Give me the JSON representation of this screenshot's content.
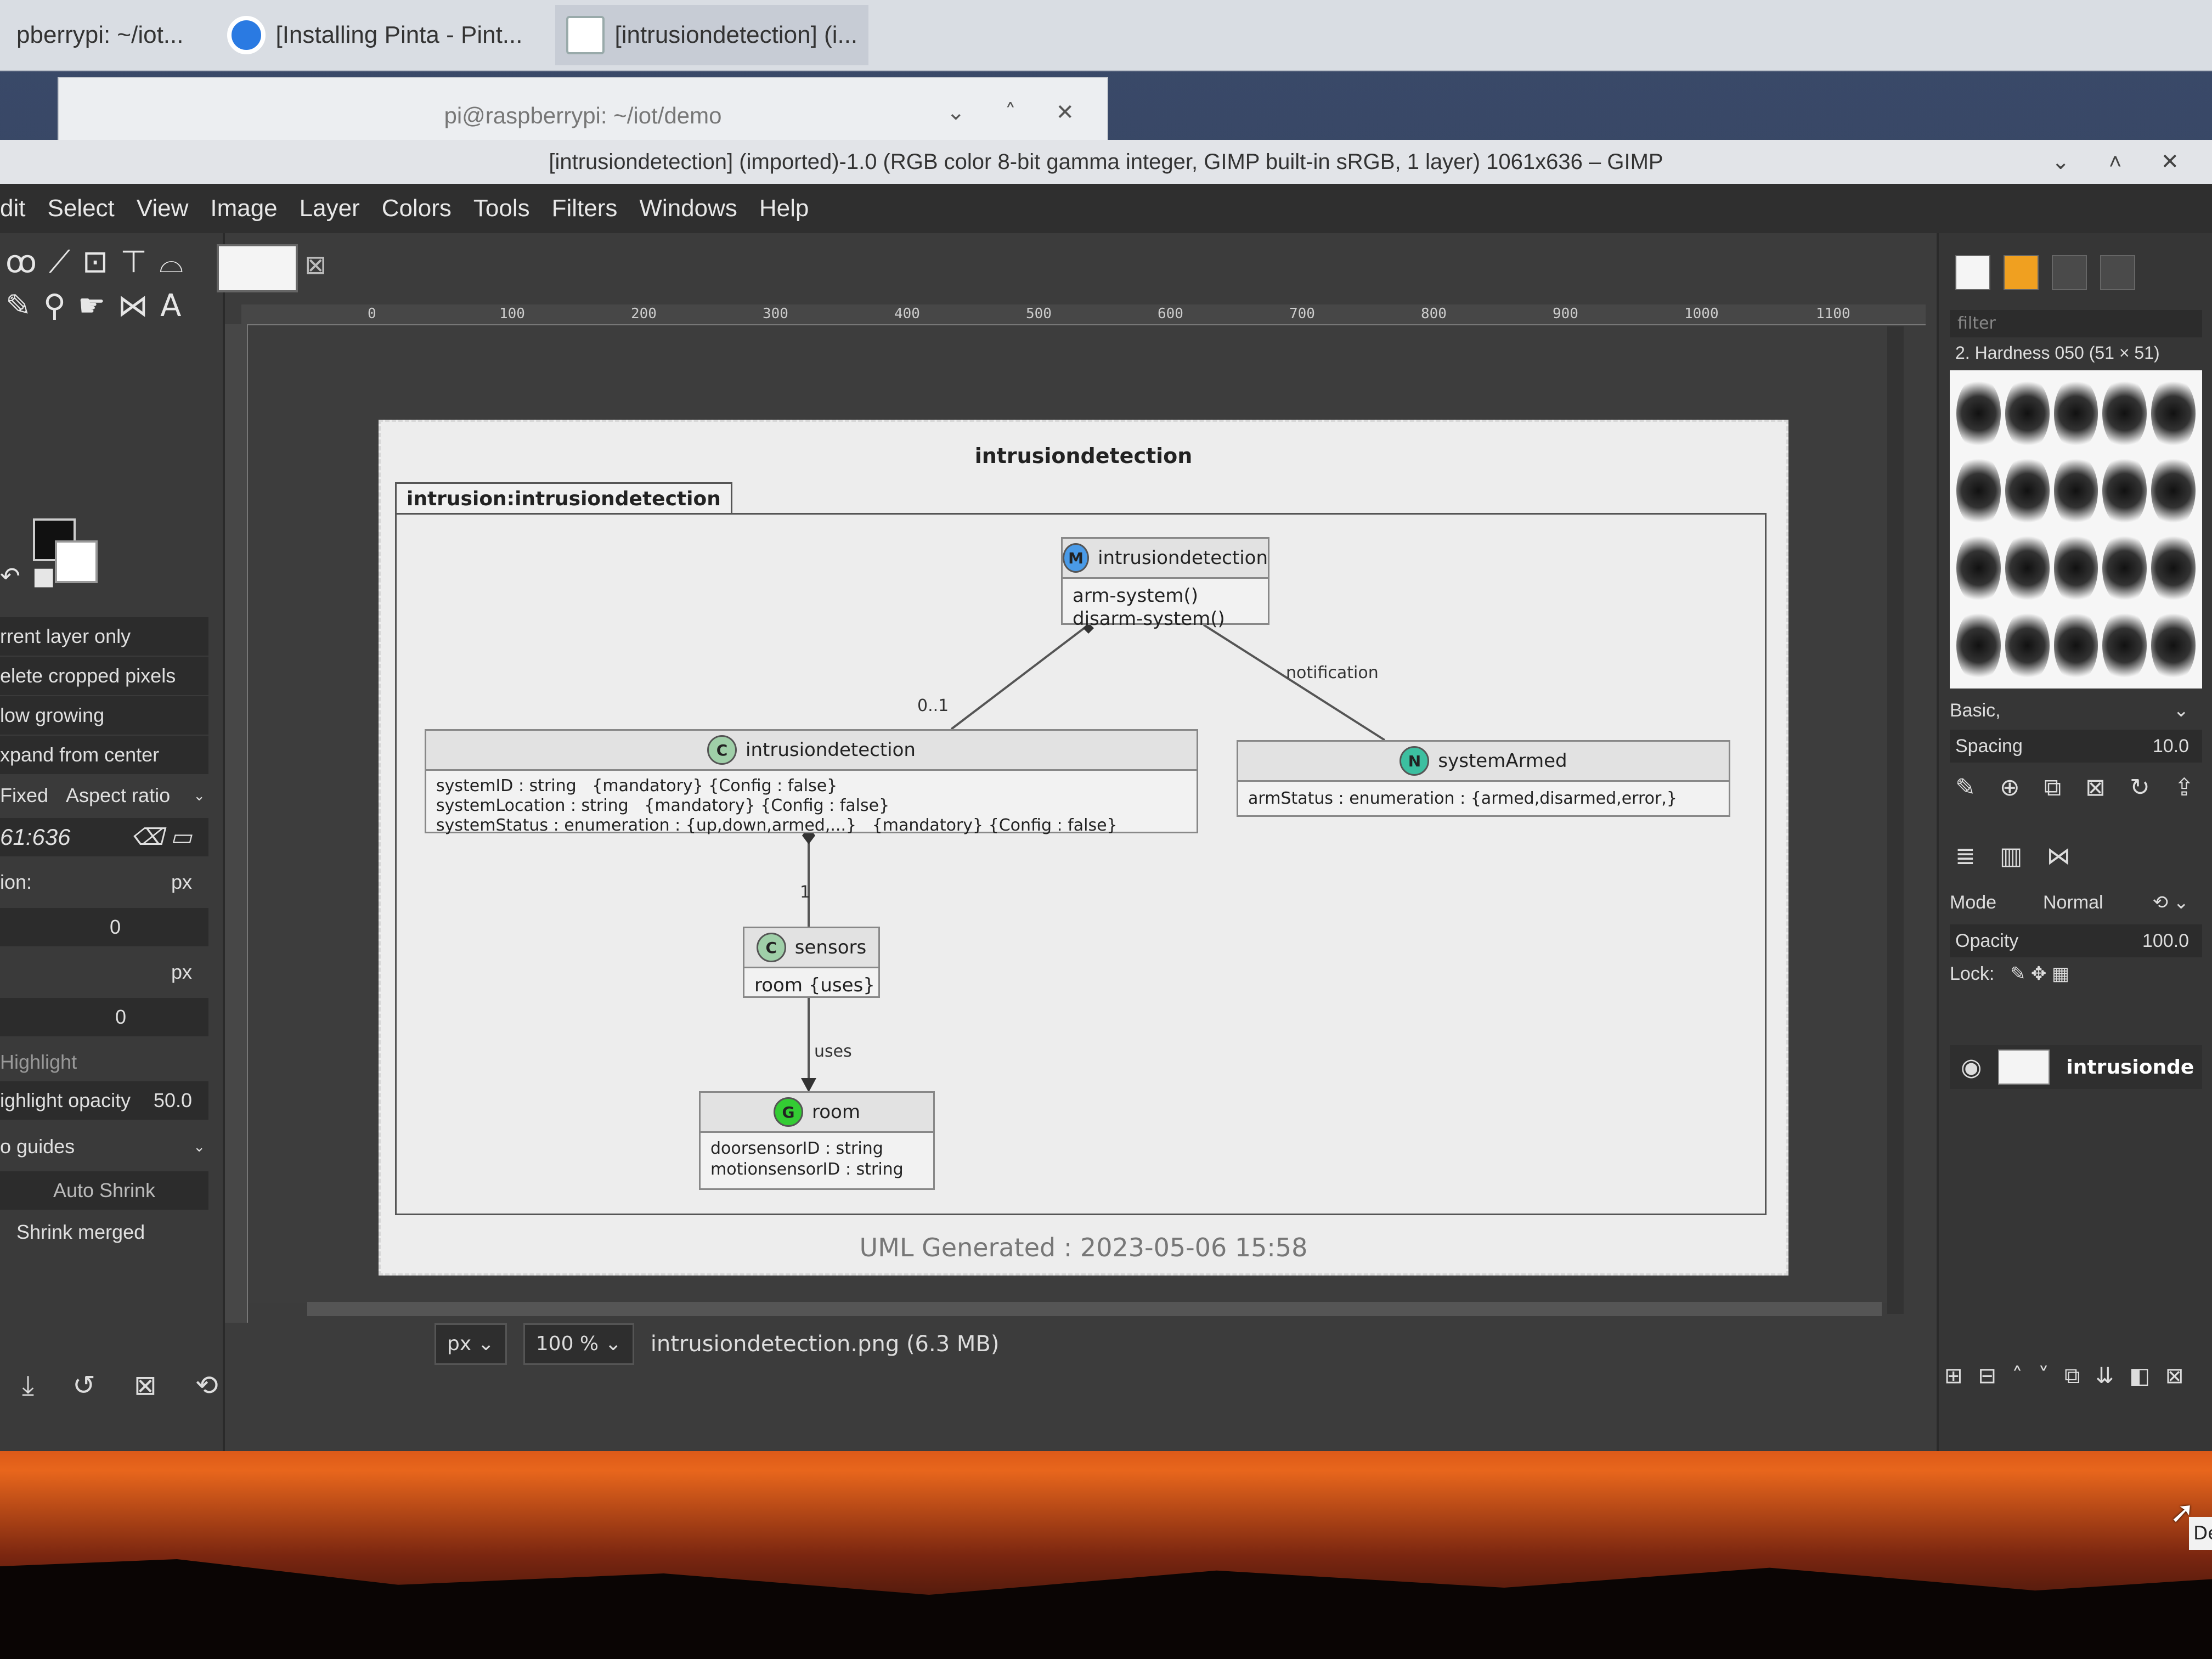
{
  "taskbar": {
    "items": [
      {
        "label": "pberrypi: ~/iot..."
      },
      {
        "label": "[Installing Pinta - Pint..."
      },
      {
        "label": "[intrusiondetection] (i..."
      }
    ]
  },
  "terminal": {
    "title": "pi@raspberrypi: ~/iot/demo",
    "controls": "⌄ ˄ ✕"
  },
  "gimp": {
    "title": "[intrusiondetection] (imported)-1.0 (RGB color 8-bit gamma integer, GIMP built-in sRGB, 1 layer) 1061x636 – GIMP",
    "window_controls": "⌄ ˄ ✕",
    "menu": [
      "dit",
      "Select",
      "View",
      "Image",
      "Layer",
      "Colors",
      "Tools",
      "Filters",
      "Windows",
      "Help"
    ],
    "tool_options": {
      "current_layer_only": "rrent layer only",
      "delete_cropped": "elete cropped pixels",
      "allow_growing": "low growing",
      "expand_center": "xpand from center",
      "fixed_label": "Fixed",
      "fixed_mode": "Aspect ratio",
      "ratio_value": "61:636",
      "position_label": "ion:",
      "unit_px": "px",
      "pos_x": "0",
      "pos_y": "0",
      "unit_px2": "px",
      "highlight_label": "Highlight",
      "highlight_opacity_label": "ighlight opacity",
      "highlight_opacity_value": "50.0",
      "guides": "o guides",
      "auto_shrink": "Auto Shrink",
      "shrink_merged": "Shrink merged"
    },
    "ruler_ticks": [
      "0",
      "100",
      "200",
      "300",
      "400",
      "500",
      "600",
      "700",
      "800",
      "900",
      "1000",
      "1100"
    ],
    "status": {
      "unit": "px",
      "zoom": "100 %",
      "file": "intrusiondetection.png (6.3 MB)"
    }
  },
  "diagram": {
    "title": "intrusiondetection",
    "package": "intrusion:intrusiondetection",
    "classes": {
      "main": {
        "badge": "M",
        "name": "intrusiondetection",
        "body": "arm-system()\ndisarm-system()",
        "color": "#4a9be8"
      },
      "id": {
        "badge": "C",
        "name": "intrusiondetection",
        "body": "systemID : string   {mandatory} {Config : false}\nsystemLocation : string   {mandatory} {Config : false}\nsystemStatus : enumeration : {up,down,armed,...}   {mandatory} {Config : false}",
        "color": "#9fcfa8"
      },
      "armed": {
        "badge": "N",
        "name": "systemArmed",
        "body": "armStatus : enumeration : {armed,disarmed,error,}",
        "color": "#3cbfa0"
      },
      "sensors": {
        "badge": "C",
        "name": "sensors",
        "body": "room {uses}",
        "color": "#9fcfa8"
      },
      "room": {
        "badge": "G",
        "name": "room",
        "body": "doorsensorID : string\nmotionsensorID : string",
        "color": "#33cc33"
      }
    },
    "edges": {
      "mult": "0..1",
      "notification": "notification",
      "one": "1",
      "uses": "uses"
    },
    "footer": "UML Generated : 2023-05-06 15:58"
  },
  "dock": {
    "filter_placeholder": "filter",
    "brush_name": "2. Hardness 050 (51 × 51)",
    "preset": "Basic,",
    "spacing_label": "Spacing",
    "spacing_value": "10.0",
    "mode_label": "Mode",
    "mode_value": "Normal",
    "opacity_label": "Opacity",
    "opacity_value": "100.0",
    "lock_label": "Lock:",
    "layer_name": "intrusionde",
    "tooltip": "De"
  }
}
